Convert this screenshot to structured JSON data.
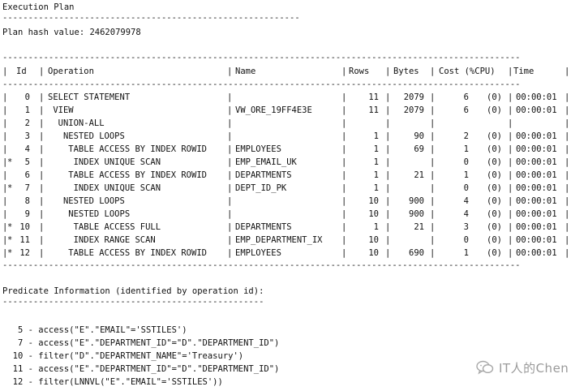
{
  "header": {
    "title": "Execution Plan",
    "rule": "----------------------------------------------------------",
    "hash_label": "Plan hash value: 2462079978"
  },
  "plan_table": {
    "rule": "-----------------------------------------------------------------------------------------------------",
    "columns": {
      "id": "Id",
      "operation": "Operation",
      "name": "Name",
      "rows": "Rows",
      "bytes": "Bytes",
      "cost": "Cost (%CPU)",
      "time": "Time"
    },
    "rows": [
      {
        "mark": " ",
        "id": "0",
        "operation": "SELECT STATEMENT",
        "name": "",
        "rows": "11",
        "bytes": "2079",
        "cost": "6",
        "cpu": "(0)",
        "time": "00:00:01"
      },
      {
        "mark": " ",
        "id": "1",
        "operation": " VIEW",
        "name": "VW_ORE_19FF4E3E",
        "rows": "11",
        "bytes": "2079",
        "cost": "6",
        "cpu": "(0)",
        "time": "00:00:01"
      },
      {
        "mark": " ",
        "id": "2",
        "operation": "  UNION-ALL",
        "name": "",
        "rows": "",
        "bytes": "",
        "cost": "",
        "cpu": "",
        "time": ""
      },
      {
        "mark": " ",
        "id": "3",
        "operation": "   NESTED LOOPS",
        "name": "",
        "rows": "1",
        "bytes": "90",
        "cost": "2",
        "cpu": "(0)",
        "time": "00:00:01"
      },
      {
        "mark": " ",
        "id": "4",
        "operation": "    TABLE ACCESS BY INDEX ROWID",
        "name": "EMPLOYEES",
        "rows": "1",
        "bytes": "69",
        "cost": "1",
        "cpu": "(0)",
        "time": "00:00:01"
      },
      {
        "mark": "*",
        "id": "5",
        "operation": "     INDEX UNIQUE SCAN",
        "name": "EMP_EMAIL_UK",
        "rows": "1",
        "bytes": "",
        "cost": "0",
        "cpu": "(0)",
        "time": "00:00:01"
      },
      {
        "mark": " ",
        "id": "6",
        "operation": "    TABLE ACCESS BY INDEX ROWID",
        "name": "DEPARTMENTS",
        "rows": "1",
        "bytes": "21",
        "cost": "1",
        "cpu": "(0)",
        "time": "00:00:01"
      },
      {
        "mark": "*",
        "id": "7",
        "operation": "     INDEX UNIQUE SCAN",
        "name": "DEPT_ID_PK",
        "rows": "1",
        "bytes": "",
        "cost": "0",
        "cpu": "(0)",
        "time": "00:00:01"
      },
      {
        "mark": " ",
        "id": "8",
        "operation": "   NESTED LOOPS",
        "name": "",
        "rows": "10",
        "bytes": "900",
        "cost": "4",
        "cpu": "(0)",
        "time": "00:00:01"
      },
      {
        "mark": " ",
        "id": "9",
        "operation": "    NESTED LOOPS",
        "name": "",
        "rows": "10",
        "bytes": "900",
        "cost": "4",
        "cpu": "(0)",
        "time": "00:00:01"
      },
      {
        "mark": "*",
        "id": "10",
        "operation": "     TABLE ACCESS FULL",
        "name": "DEPARTMENTS",
        "rows": "1",
        "bytes": "21",
        "cost": "3",
        "cpu": "(0)",
        "time": "00:00:01"
      },
      {
        "mark": "*",
        "id": "11",
        "operation": "     INDEX RANGE SCAN",
        "name": "EMP_DEPARTMENT_IX",
        "rows": "10",
        "bytes": "",
        "cost": "0",
        "cpu": "(0)",
        "time": "00:00:01"
      },
      {
        "mark": "*",
        "id": "12",
        "operation": "    TABLE ACCESS BY INDEX ROWID",
        "name": "EMPLOYEES",
        "rows": "10",
        "bytes": "690",
        "cost": "1",
        "cpu": "(0)",
        "time": "00:00:01"
      }
    ]
  },
  "predicates": {
    "title": "Predicate Information (identified by operation id):",
    "rule": "---------------------------------------------------",
    "items": [
      "   5 - access(\"E\".\"EMAIL\"='SSTILES')",
      "   7 - access(\"E\".\"DEPARTMENT_ID\"=\"D\".\"DEPARTMENT_ID\")",
      "  10 - filter(\"D\".\"DEPARTMENT_NAME\"='Treasury')",
      "  11 - access(\"E\".\"DEPARTMENT_ID\"=\"D\".\"DEPARTMENT_ID\")",
      "  12 - filter(LNNVL(\"E\".\"EMAIL\"='SSTILES'))"
    ]
  },
  "watermark": {
    "text": "IT人的Chen"
  }
}
